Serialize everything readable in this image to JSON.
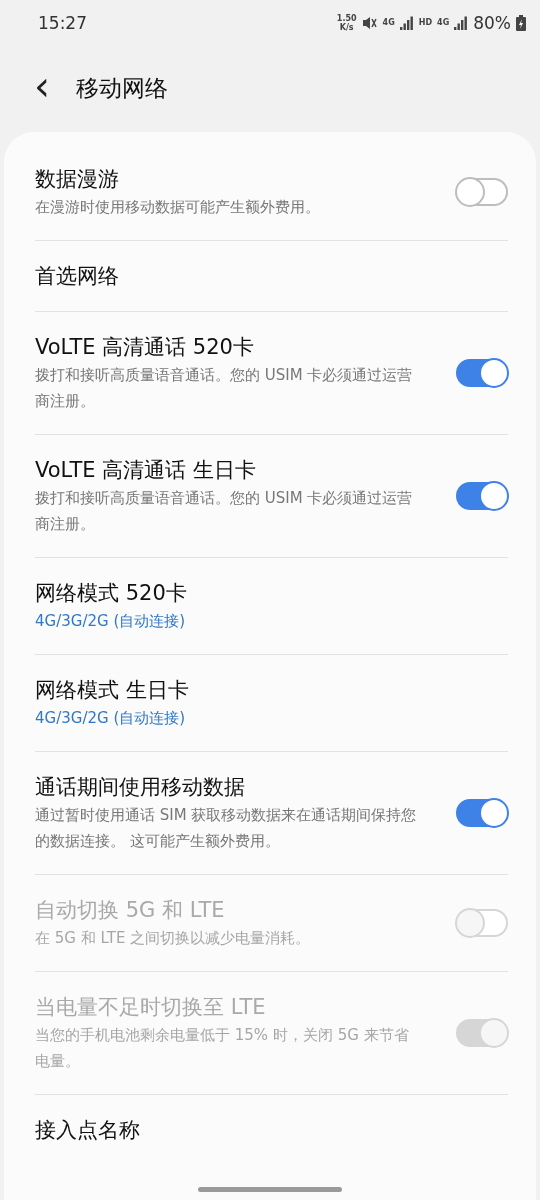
{
  "status_bar": {
    "time": "15:27",
    "speed_value": "1.50",
    "speed_unit": "K/s",
    "sim1_network": "4G",
    "hd": "HD",
    "sim2_network": "4G",
    "battery": "80%"
  },
  "header": {
    "back": "‹",
    "title": "移动网络"
  },
  "settings": [
    {
      "kind": "toggle",
      "title": "数据漫游",
      "subtitle": "在漫游时使用移动数据可能产生额外费用。",
      "on": false,
      "disabled": false
    },
    {
      "kind": "plain",
      "title": "首选网络"
    },
    {
      "kind": "toggle",
      "title": "VoLTE 高清通话 520卡",
      "subtitle": "拨打和接听高质量语音通话。您的 USIM 卡必须通过运营商注册。",
      "on": true,
      "disabled": false
    },
    {
      "kind": "toggle",
      "title": "VoLTE 高清通话 生日卡",
      "subtitle": "拨打和接听高质量语音通话。您的 USIM 卡必须通过运营商注册。",
      "on": true,
      "disabled": false
    },
    {
      "kind": "value",
      "title": "网络模式 520卡",
      "value": "4G/3G/2G (自动连接)"
    },
    {
      "kind": "value",
      "title": "网络模式 生日卡",
      "value": "4G/3G/2G (自动连接)"
    },
    {
      "kind": "toggle",
      "title": "通话期间使用移动数据",
      "subtitle": "通过暂时使用通话 SIM 获取移动数据来在通话期间保持您的数据连接。 这可能产生额外费用。",
      "on": true,
      "disabled": false
    },
    {
      "kind": "toggle",
      "title": "自动切换 5G 和 LTE",
      "subtitle": "在 5G 和 LTE 之间切换以减少电量消耗。",
      "on": false,
      "disabled": true
    },
    {
      "kind": "toggle",
      "title": "当电量不足时切换至 LTE",
      "subtitle": "当您的手机电池剩余电量低于 15% 时，关闭 5G 来节省电量。",
      "on": true,
      "disabled": true
    },
    {
      "kind": "plain",
      "title": "接入点名称"
    }
  ]
}
